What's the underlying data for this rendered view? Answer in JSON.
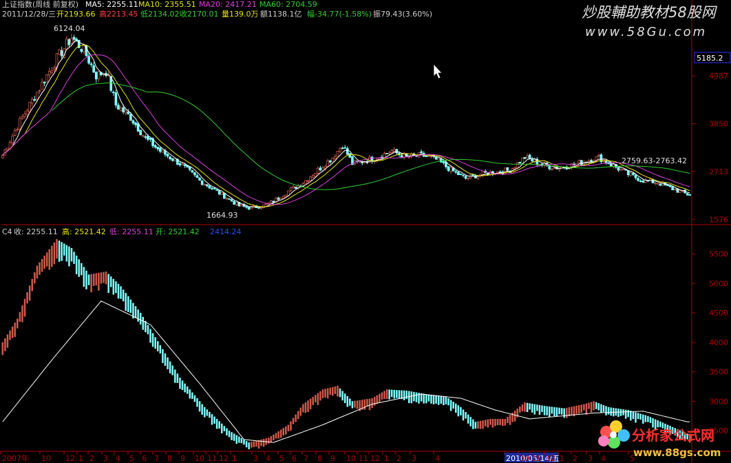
{
  "watermark_top": {
    "title": "炒股輔助教材58股网",
    "url": "www.58Gu.com"
  },
  "watermark_bottom": {
    "title": "分析家公式网",
    "url": "www.88gs.com"
  },
  "info_line1": {
    "name": "上证指数(周线 前复权)",
    "ma5": "MA5: 2255.11",
    "ma10": "MA10: 2355.51",
    "ma20": "MA20: 2417.21",
    "ma60": "MA60: 2704.59"
  },
  "info_line2": {
    "date": "2011/12/28/三",
    "open": "开2193.66",
    "high": "高2213.45",
    "low": "低2134.02",
    "close": "收2170.01",
    "vol": "量139.0万",
    "amount": "额1138.1亿",
    "change": "幅-34.77(-1.58%)",
    "amplitude": "振79.43(3.60%)"
  },
  "upper_labels": {
    "peak": "6124.04",
    "trough": "1664.93",
    "range": "2759.63-2763.42",
    "current_price": "5185.2"
  },
  "lower_info": {
    "name": "C4",
    "close": "收: 2255.11",
    "high": "高: 2521.42",
    "low": "低: 2255.11",
    "open": "开: 2521.42",
    "extra": "2414.24"
  },
  "x_axis": {
    "labels": [
      "2007年",
      "10",
      "12",
      "1",
      "2",
      "3",
      "4",
      "5",
      "6",
      "7",
      "8",
      "9",
      "10",
      "11",
      "12",
      "1",
      "3",
      "4",
      "5",
      "6",
      "7",
      "8",
      "9",
      "10",
      "11",
      "12",
      "1",
      "2",
      "3",
      "4",
      "2010/05/14/五",
      "10",
      "11",
      "12",
      "1",
      "2",
      "3",
      "4",
      "5"
    ]
  },
  "colors": {
    "up": "#d05a4a",
    "down": "#80ffff",
    "ma5": "#ffffff",
    "ma10": "#e8e800",
    "ma20": "#e040e0",
    "ma60": "#30d030",
    "axis": "#b00000"
  },
  "chart_data": [
    {
      "type": "candlestick",
      "title": "上证指数(周线 前复权)",
      "y_ticks": [
        4987,
        3850,
        2713,
        1576
      ],
      "ylim": [
        1450,
        6300
      ],
      "annotations": [
        "6124.04",
        "1664.93",
        "2759.63-2763.42"
      ],
      "series": [
        {
          "name": "MA5",
          "values": []
        },
        {
          "name": "MA10",
          "values": []
        },
        {
          "name": "MA20",
          "values": []
        },
        {
          "name": "MA60",
          "values": []
        }
      ],
      "close_keypoints": [
        [
          0,
          3100
        ],
        [
          6,
          3800
        ],
        [
          14,
          4600
        ],
        [
          22,
          5400
        ],
        [
          28,
          5900
        ],
        [
          33,
          5600
        ],
        [
          38,
          5000
        ],
        [
          42,
          5100
        ],
        [
          46,
          4300
        ],
        [
          52,
          4000
        ],
        [
          58,
          3500
        ],
        [
          64,
          3200
        ],
        [
          72,
          2900
        ],
        [
          80,
          2500
        ],
        [
          88,
          2200
        ],
        [
          96,
          1900
        ],
        [
          100,
          1850
        ],
        [
          106,
          1900
        ],
        [
          110,
          2000
        ],
        [
          116,
          2250
        ],
        [
          122,
          2450
        ],
        [
          128,
          2750
        ],
        [
          134,
          3050
        ],
        [
          138,
          3350
        ],
        [
          142,
          2900
        ],
        [
          146,
          2950
        ],
        [
          152,
          3050
        ],
        [
          158,
          3200
        ],
        [
          164,
          3050
        ],
        [
          170,
          3100
        ],
        [
          176,
          3000
        ],
        [
          182,
          2750
        ],
        [
          188,
          2550
        ],
        [
          194,
          2650
        ],
        [
          200,
          2700
        ],
        [
          206,
          2750
        ],
        [
          212,
          3050
        ],
        [
          218,
          2900
        ],
        [
          224,
          2800
        ],
        [
          230,
          2850
        ],
        [
          236,
          2950
        ],
        [
          242,
          3050
        ],
        [
          248,
          2850
        ],
        [
          254,
          2650
        ],
        [
          260,
          2500
        ],
        [
          266,
          2450
        ],
        [
          272,
          2300
        ],
        [
          278,
          2170
        ]
      ]
    },
    {
      "type": "bar",
      "title": "C4",
      "y_ticks": [
        5500,
        5000,
        4500,
        4000,
        3500,
        3000,
        2500
      ],
      "ylim": [
        2150,
        5950
      ],
      "close_keypoints": [
        [
          0,
          4000
        ],
        [
          6,
          4400
        ],
        [
          14,
          5300
        ],
        [
          22,
          5750
        ],
        [
          28,
          5600
        ],
        [
          35,
          5150
        ],
        [
          42,
          5200
        ],
        [
          48,
          4950
        ],
        [
          56,
          4500
        ],
        [
          64,
          3950
        ],
        [
          72,
          3400
        ],
        [
          82,
          2900
        ],
        [
          92,
          2500
        ],
        [
          100,
          2300
        ],
        [
          108,
          2380
        ],
        [
          116,
          2600
        ],
        [
          122,
          2950
        ],
        [
          130,
          3200
        ],
        [
          136,
          3260
        ],
        [
          142,
          3000
        ],
        [
          150,
          3050
        ],
        [
          156,
          3200
        ],
        [
          164,
          3180
        ],
        [
          172,
          3120
        ],
        [
          180,
          3080
        ],
        [
          186,
          2900
        ],
        [
          192,
          2650
        ],
        [
          198,
          2700
        ],
        [
          204,
          2700
        ],
        [
          212,
          2980
        ],
        [
          220,
          2920
        ],
        [
          228,
          2880
        ],
        [
          236,
          2950
        ],
        [
          240,
          3000
        ],
        [
          246,
          2900
        ],
        [
          254,
          2850
        ],
        [
          262,
          2750
        ],
        [
          270,
          2600
        ],
        [
          278,
          2450
        ]
      ],
      "signal_line_keypoints": [
        [
          0,
          2650
        ],
        [
          20,
          3700
        ],
        [
          40,
          4700
        ],
        [
          60,
          4300
        ],
        [
          80,
          3300
        ],
        [
          98,
          2350
        ],
        [
          110,
          2300
        ],
        [
          130,
          2600
        ],
        [
          150,
          2950
        ],
        [
          170,
          3120
        ],
        [
          186,
          3050
        ],
        [
          200,
          2850
        ],
        [
          214,
          2700
        ],
        [
          240,
          2800
        ],
        [
          260,
          2830
        ],
        [
          278,
          2650
        ]
      ]
    }
  ]
}
